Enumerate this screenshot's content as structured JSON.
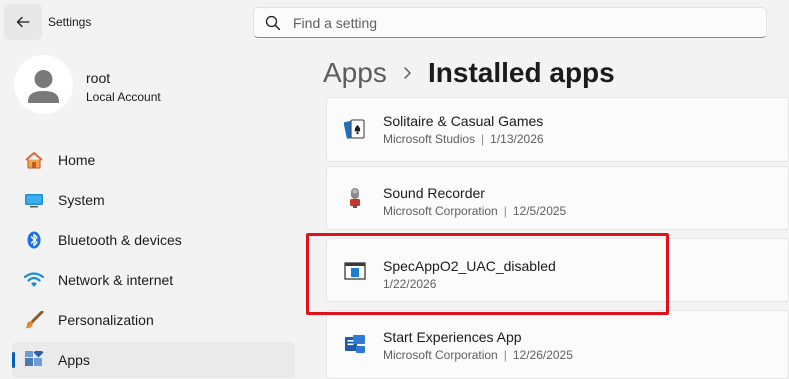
{
  "window": {
    "title": "Settings"
  },
  "search": {
    "placeholder": "Find a setting"
  },
  "profile": {
    "name": "root",
    "account_type": "Local Account"
  },
  "sidebar": {
    "items": [
      {
        "label": "Home",
        "icon": "home-icon"
      },
      {
        "label": "System",
        "icon": "system-icon"
      },
      {
        "label": "Bluetooth & devices",
        "icon": "bluetooth-icon"
      },
      {
        "label": "Network & internet",
        "icon": "wifi-icon"
      },
      {
        "label": "Personalization",
        "icon": "brush-icon"
      },
      {
        "label": "Apps",
        "icon": "apps-icon",
        "selected": true
      }
    ]
  },
  "breadcrumb": {
    "parent": "Apps",
    "current": "Installed apps"
  },
  "apps": [
    {
      "name": "Solitaire & Casual Games",
      "publisher": "Microsoft Studios",
      "date": "1/13/2026",
      "icon": "cards-icon"
    },
    {
      "name": "Sound Recorder",
      "publisher": "Microsoft Corporation",
      "date": "12/5/2025",
      "icon": "microphone-icon"
    },
    {
      "name": "SpecAppO2_UAC_disabled",
      "publisher": "",
      "date": "1/22/2026",
      "icon": "window-app-icon",
      "highlighted": true
    },
    {
      "name": "Start Experiences App",
      "publisher": "Microsoft Corporation",
      "date": "12/26/2025",
      "icon": "start-experiences-icon"
    }
  ],
  "colors": {
    "accent": "#005fb8",
    "highlight_border": "#e0101c",
    "background": "#f3f3f3",
    "card": "#fbfbfb"
  }
}
